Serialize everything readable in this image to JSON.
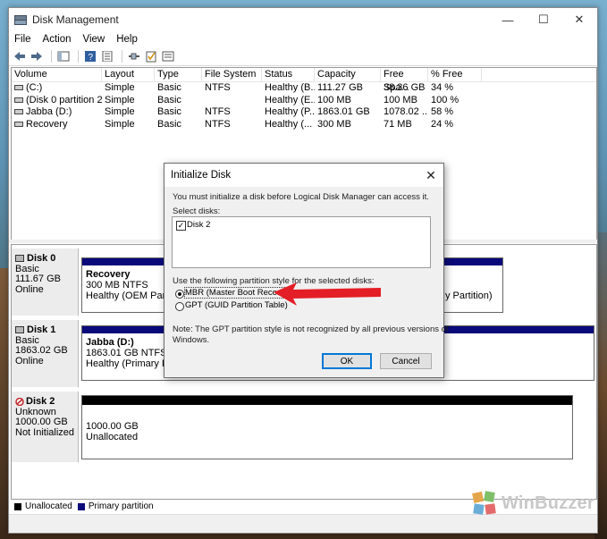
{
  "window": {
    "title": "Disk Management",
    "controls": {
      "minimize": "—",
      "maximize": "☐",
      "close": "✕"
    }
  },
  "menu": [
    "File",
    "Action",
    "View",
    "Help"
  ],
  "volume_table": {
    "columns": [
      "Volume",
      "Layout",
      "Type",
      "File System",
      "Status",
      "Capacity",
      "Free Spa...",
      "% Free"
    ],
    "rows": [
      [
        "(C:)",
        "Simple",
        "Basic",
        "NTFS",
        "Healthy (B...",
        "111.27 GB",
        "38.36 GB",
        "34 %"
      ],
      [
        "(Disk 0 partition 2)",
        "Simple",
        "Basic",
        "",
        "Healthy (E...",
        "100 MB",
        "100 MB",
        "100 %"
      ],
      [
        "Jabba (D:)",
        "Simple",
        "Basic",
        "NTFS",
        "Healthy (P...",
        "1863.01 GB",
        "1078.02 ...",
        "58 %"
      ],
      [
        "Recovery",
        "Simple",
        "Basic",
        "NTFS",
        "Healthy (...",
        "300 MB",
        "71 MB",
        "24 %"
      ]
    ]
  },
  "disks": [
    {
      "name": "Disk 0",
      "type": "Basic",
      "size": "111.67 GB",
      "status": "Online",
      "partition": {
        "name": "Recovery",
        "size": "300 MB NTFS",
        "status": "Healthy (OEM Partitio"
      },
      "partition_right_status": "y Partition)"
    },
    {
      "name": "Disk 1",
      "type": "Basic",
      "size": "1863.02 GB",
      "status": "Online",
      "partition": {
        "name": "Jabba  (D:)",
        "size": "1863.01 GB NTFS",
        "status": "Healthy (Primary Parti"
      }
    },
    {
      "name": "Disk 2",
      "type": "Unknown",
      "size": "1000.00 GB",
      "status": "Not Initialized",
      "partition": {
        "size": "1000.00 GB",
        "status": "Unallocated"
      }
    }
  ],
  "legend": {
    "unallocated": "Unallocated",
    "primary": "Primary partition",
    "colors": {
      "unallocated": "#000000",
      "primary": "#0a0a7a"
    }
  },
  "dialog": {
    "title": "Initialize Disk",
    "intro": "You must initialize a disk before Logical Disk Manager can access it.",
    "select_label": "Select disks:",
    "disk_item": "Disk 2",
    "disk_checked": true,
    "style_label": "Use the following partition style for the selected disks:",
    "option_mbr": "MBR (Master Boot Record)",
    "option_gpt": "GPT (GUID Partition Table)",
    "selected": "MBR",
    "note_line1": "Note: The GPT partition style is not recognized by all previous versions of",
    "note_line2": "Windows.",
    "ok": "OK",
    "cancel": "Cancel"
  },
  "watermark": "WinBuzzer",
  "accent_color": "#e41e26"
}
